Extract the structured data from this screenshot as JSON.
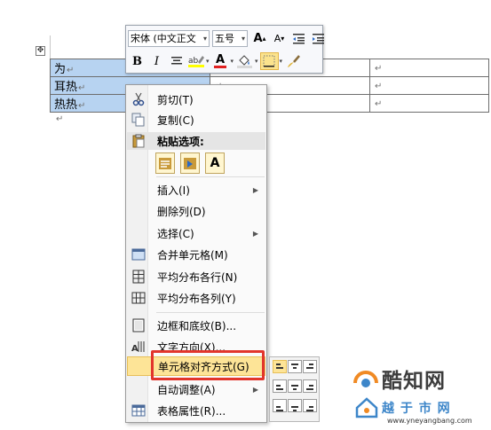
{
  "table": {
    "handle": "✥",
    "rows": [
      {
        "c1": "为",
        "c2": "",
        "c3": ""
      },
      {
        "c1": "耳热",
        "c2": "",
        "c3": ""
      },
      {
        "c1": "热热",
        "c2": "",
        "c3": ""
      }
    ],
    "para_mark": "↵"
  },
  "mini_toolbar": {
    "font_family": "宋体 (中文正文",
    "font_size": "五号",
    "grow_font": "A",
    "shrink_font": "A",
    "bold": "B",
    "italic": "I",
    "font_color": "A",
    "format_painter_icon": "brush-icon"
  },
  "context_menu": {
    "cut": "剪切(T)",
    "copy": "复制(C)",
    "paste_options": "粘贴选项:",
    "paste_icons": [
      "keep-formatting",
      "merge-formatting",
      "A"
    ],
    "insert": "插入(I)",
    "delete_column": "删除列(D)",
    "select": "选择(C)",
    "merge_cells": "合并单元格(M)",
    "distribute_rows": "平均分布各行(N)",
    "distribute_columns": "平均分布各列(Y)",
    "borders_shading": "边框和底纹(B)...",
    "text_direction": "文字方向(X)...",
    "cell_alignment": "单元格对齐方式(G)",
    "autofit": "自动调整(A)",
    "table_properties": "表格属性(R)..."
  },
  "watermark": {
    "brand": "酷知网",
    "sub": "越 于 市 网",
    "url": "www.yneyangbang.com"
  },
  "colors": {
    "selection": "#b7d3f1",
    "menu_highlight": "#fde497",
    "annotation_red": "#e2352c"
  }
}
